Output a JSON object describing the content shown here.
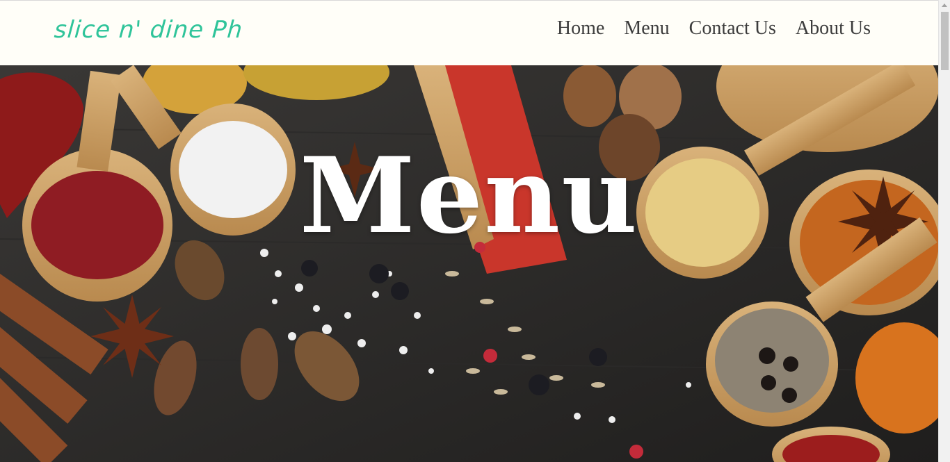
{
  "header": {
    "logo_text": "slice n' dine Ph",
    "nav": [
      {
        "label": "Home"
      },
      {
        "label": "Menu"
      },
      {
        "label": "Contact Us"
      },
      {
        "label": "About Us"
      }
    ]
  },
  "hero": {
    "title": "Menu",
    "background_image": "spices-on-wooden-spoons-photo"
  },
  "colors": {
    "logo": "#2fc49a",
    "nav_text": "#3c3c3c",
    "header_bg": "#fffef8",
    "hero_text": "#ffffff"
  }
}
